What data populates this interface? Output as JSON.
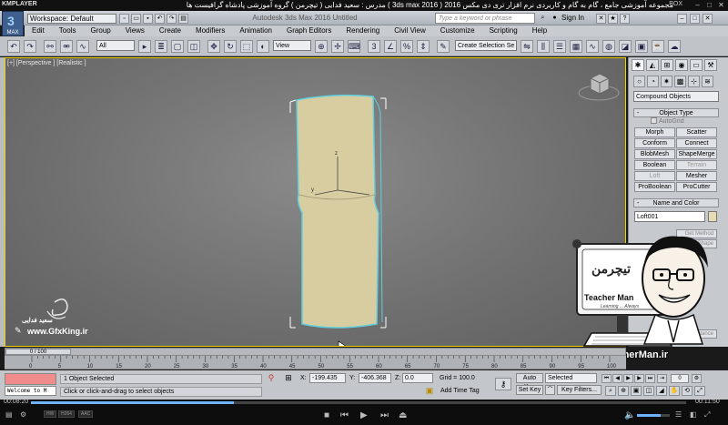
{
  "player": {
    "name": "KMPLAYER",
    "title": "مجموعه آموزشی جامع ، گام به گام و کاربردی نرم افزار تری دی مکس 2016 ( 3ds max 2016 )    مدرس : سعید فدایی ( تیچرمن ) گروه آموزشی پادشاه گرافیست ها",
    "tag": "BOX",
    "time_current": "00:08:20",
    "time_total": "00:11:50",
    "progress": 0.31,
    "tags": [
      "HW",
      "H264",
      "AAC"
    ]
  },
  "max": {
    "logo_label": "MAX",
    "workspace": "Workspace: Default",
    "app_title": "Autodesk 3ds Max 2016   Untitled",
    "help_placeholder": "Type a keyword or phrase",
    "sign_in": "Sign In",
    "menus": [
      "Edit",
      "Tools",
      "Group",
      "Views",
      "Create",
      "Modifiers",
      "Animation",
      "Graph Editors",
      "Rendering",
      "Civil View",
      "Customize",
      "Scripting",
      "Help"
    ],
    "toolbar": {
      "filter": "All",
      "ref_coord": "View",
      "named_sel": "Create Selection Se",
      "snap_label": "3"
    },
    "viewport_label": "[+] [Perspective ] [Realistic ]",
    "command_panel": {
      "category": "Compound Objects",
      "object_type_title": "Object Type",
      "autogrid": "AutoGrid",
      "buttons": [
        {
          "label": "Morph",
          "enabled": true
        },
        {
          "label": "Scatter",
          "enabled": true
        },
        {
          "label": "Conform",
          "enabled": true
        },
        {
          "label": "Connect",
          "enabled": true
        },
        {
          "label": "BlobMesh",
          "enabled": true
        },
        {
          "label": "ShapeMerge",
          "enabled": true
        },
        {
          "label": "Boolean",
          "enabled": true
        },
        {
          "label": "Terrain",
          "enabled": false
        },
        {
          "label": "Loft",
          "enabled": false
        },
        {
          "label": "Mesher",
          "enabled": true
        },
        {
          "label": "ProBoolean",
          "enabled": true
        },
        {
          "label": "ProCutter",
          "enabled": true
        }
      ],
      "name_color_title": "Name and Color",
      "object_name": "Loft001",
      "partial_buttons": [
        "Get Method",
        "Get Shape",
        "Instance"
      ]
    },
    "timeline": {
      "slider_label": "0 / 100",
      "ticks": [
        "0",
        "5",
        "10",
        "15",
        "20",
        "25",
        "30",
        "35",
        "40",
        "45",
        "50",
        "55",
        "60",
        "65",
        "70",
        "75",
        "80",
        "85",
        "90",
        "95",
        "100"
      ]
    },
    "status": {
      "listener_text": "Welcome to M",
      "selection": "1 Object Selected",
      "prompt": "Click or click-and-drag to select objects",
      "x_label": "X:",
      "x_value": "-199.435",
      "y_label": "Y:",
      "y_value": "-406.368",
      "z_label": "Z:",
      "z_value": "0.0",
      "grid": "Grid = 100.0",
      "add_time_tag": "Add Time Tag",
      "auto_key": "Auto Key",
      "set_key": "Set Key",
      "selected": "Selected",
      "key_filters": "Key Filters...",
      "frame": "0"
    }
  },
  "overlay": {
    "site": "www.TeacherMan.ir",
    "teacher_text": "Teacher Man",
    "teacher_sub": "Learning ... Always",
    "teacher_fa": "تیچرمن",
    "gfx_name": "سعید فدایی",
    "gfx_url": "www.GfxKing.ir"
  },
  "colors": {
    "viewport_border": "#f2d000",
    "object_fill": "#d8cda0",
    "object_outline": "#5fd0e0",
    "progress": "#6fb3ff",
    "maxscript": "#f08c8c"
  }
}
